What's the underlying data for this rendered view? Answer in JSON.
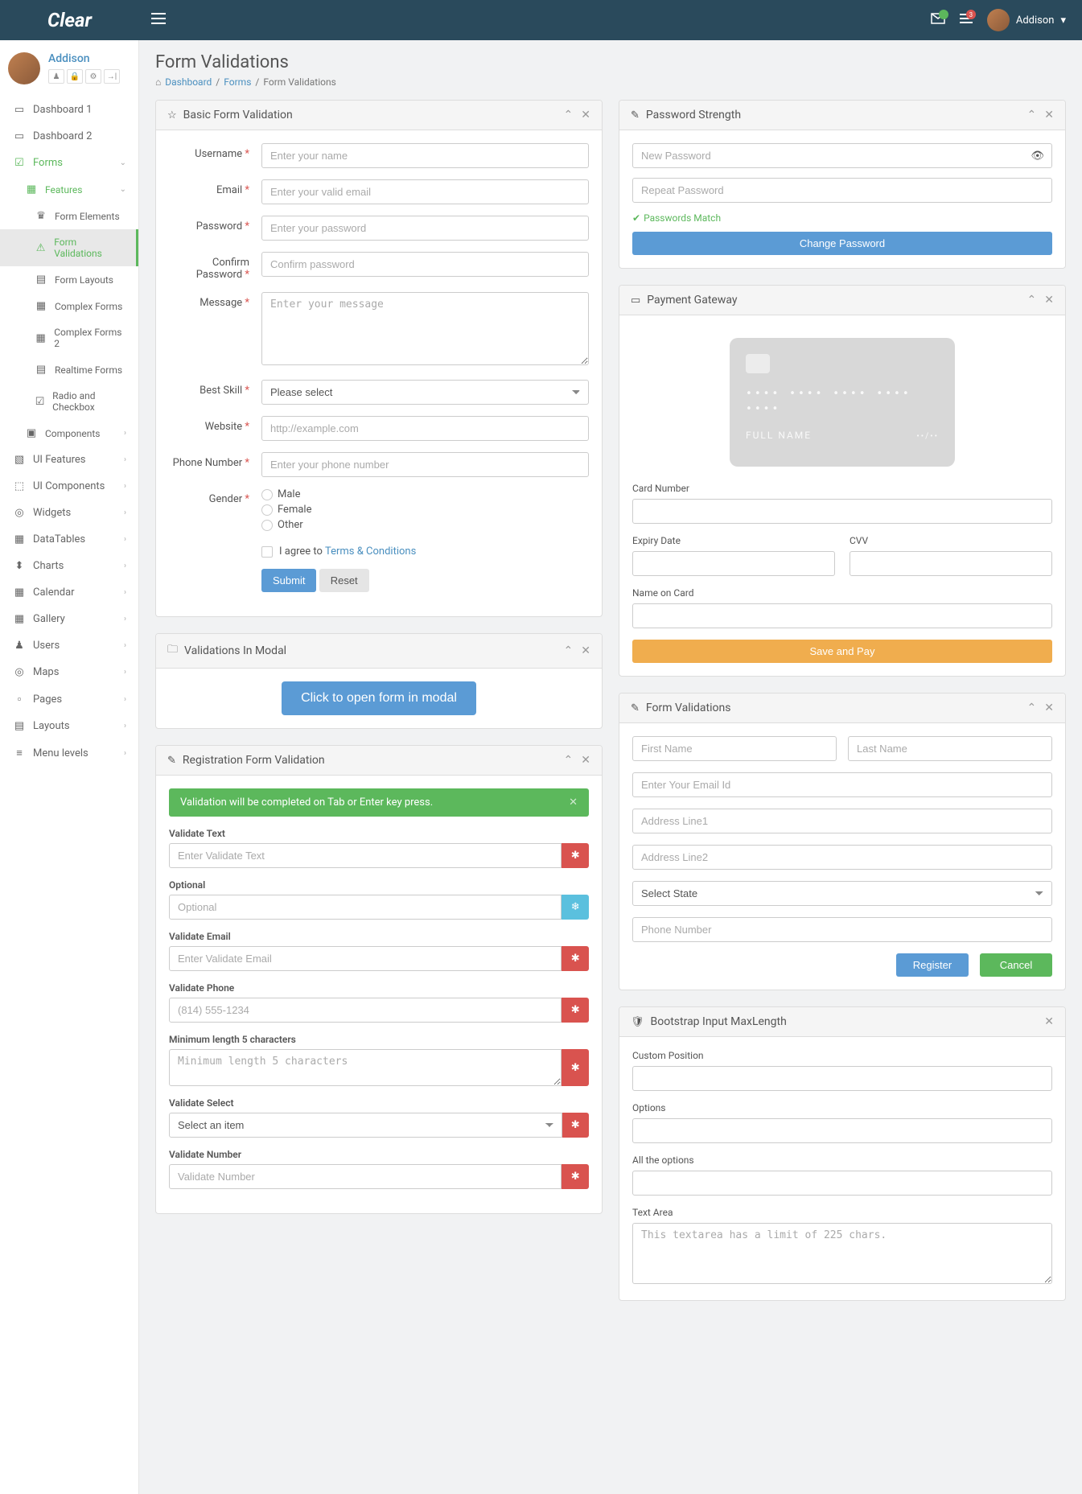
{
  "brand": "Clear",
  "user": {
    "name": "Addison"
  },
  "topbar": {
    "notif_count": "3"
  },
  "page": {
    "title": "Form Validations",
    "breadcrumb": [
      "Dashboard",
      "Forms",
      "Form Validations"
    ]
  },
  "sidebar": {
    "items": [
      {
        "icon": "▭",
        "label": "Dashboard 1"
      },
      {
        "icon": "▭",
        "label": "Dashboard 2"
      },
      {
        "icon": "☑",
        "label": "Forms",
        "green": true,
        "chev": "down"
      },
      {
        "icon": "▦",
        "label": "Features",
        "sub": true,
        "green": true,
        "chev": "down"
      },
      {
        "icon": "♛",
        "label": "Form Elements",
        "sub2": true
      },
      {
        "icon": "⚠",
        "label": "Form Validations",
        "sub2": true,
        "active": true
      },
      {
        "icon": "▤",
        "label": "Form Layouts",
        "sub2": true
      },
      {
        "icon": "▦",
        "label": "Complex Forms",
        "sub2": true
      },
      {
        "icon": "▦",
        "label": "Complex Forms 2",
        "sub2": true
      },
      {
        "icon": "▤",
        "label": "Realtime Forms",
        "sub2": true
      },
      {
        "icon": "☑",
        "label": "Radio and Checkbox",
        "sub2": true
      },
      {
        "icon": "▣",
        "label": "Components",
        "sub": true,
        "chev": "right"
      },
      {
        "icon": "▧",
        "label": "UI Features",
        "chev": "right"
      },
      {
        "icon": "⬚",
        "label": "UI Components",
        "chev": "right"
      },
      {
        "icon": "◎",
        "label": "Widgets",
        "chev": "right"
      },
      {
        "icon": "▦",
        "label": "DataTables",
        "chev": "right"
      },
      {
        "icon": "⬍",
        "label": "Charts",
        "chev": "right"
      },
      {
        "icon": "▦",
        "label": "Calendar",
        "chev": "right"
      },
      {
        "icon": "▦",
        "label": "Gallery",
        "chev": "right"
      },
      {
        "icon": "♟",
        "label": "Users",
        "chev": "right"
      },
      {
        "icon": "◎",
        "label": "Maps",
        "chev": "right"
      },
      {
        "icon": "▫",
        "label": "Pages",
        "chev": "right"
      },
      {
        "icon": "▤",
        "label": "Layouts",
        "chev": "right"
      },
      {
        "icon": "≡",
        "label": "Menu levels",
        "chev": "right"
      }
    ]
  },
  "basic": {
    "title": "Basic Form Validation",
    "username": {
      "label": "Username",
      "ph": "Enter your name"
    },
    "email": {
      "label": "Email",
      "ph": "Enter your valid email"
    },
    "password": {
      "label": "Password",
      "ph": "Enter your password"
    },
    "confirm": {
      "label": "Confirm Password",
      "ph": "Confirm password"
    },
    "message": {
      "label": "Message",
      "ph": "Enter your message"
    },
    "skill": {
      "label": "Best Skill",
      "ph": "Please select"
    },
    "website": {
      "label": "Website",
      "ph": "http://example.com"
    },
    "phone": {
      "label": "Phone Number",
      "ph": "Enter your phone number"
    },
    "gender": {
      "label": "Gender",
      "options": [
        "Male",
        "Female",
        "Other"
      ]
    },
    "agree_pre": "I agree to ",
    "agree_link": "Terms & Conditions",
    "submit": "Submit",
    "reset": "Reset"
  },
  "modal": {
    "title": "Validations In Modal",
    "btn": "Click to open form in modal"
  },
  "reg": {
    "title": "Registration Form Validation",
    "alert": "Validation will be completed on Tab or Enter key press.",
    "fields": [
      {
        "label": "Validate Text",
        "ph": "Enter Validate Text",
        "btn": "danger",
        "type": "input"
      },
      {
        "label": "Optional",
        "ph": "Optional",
        "btn": "info",
        "type": "input"
      },
      {
        "label": "Validate Email",
        "ph": "Enter Validate Email",
        "btn": "danger",
        "type": "input"
      },
      {
        "label": "Validate Phone",
        "ph": "(814) 555-1234",
        "btn": "danger",
        "type": "input"
      },
      {
        "label": "Minimum length 5 characters",
        "ph": "Minimum length 5 characters",
        "btn": "danger",
        "type": "textarea"
      },
      {
        "label": "Validate Select",
        "ph": "Select an item",
        "btn": "danger",
        "type": "select"
      },
      {
        "label": "Validate Number",
        "ph": "Validate Number",
        "btn": "danger",
        "type": "input"
      }
    ]
  },
  "pw": {
    "title": "Password Strength",
    "new_ph": "New Password",
    "repeat_ph": "Repeat Password",
    "match": "Passwords Match",
    "btn": "Change Password"
  },
  "payment": {
    "title": "Payment Gateway",
    "card_name": "FULL NAME",
    "labels": {
      "num": "Card Number",
      "exp": "Expiry Date",
      "cvv": "CVV",
      "name": "Name on Card"
    },
    "btn": "Save and Pay"
  },
  "fv": {
    "title": "Form Validations",
    "first_ph": "First Name",
    "last_ph": "Last Name",
    "email_ph": "Enter Your Email Id",
    "addr1_ph": "Address Line1",
    "addr2_ph": "Address Line2",
    "state_ph": "Select State",
    "phone_ph": "Phone Number",
    "register": "Register",
    "cancel": "Cancel"
  },
  "maxlen": {
    "title": "Bootstrap Input MaxLength",
    "labels": [
      "Custom Position",
      "Options",
      "All the options",
      "Text Area"
    ],
    "ta_ph": "This textarea has a limit of 225 chars."
  }
}
